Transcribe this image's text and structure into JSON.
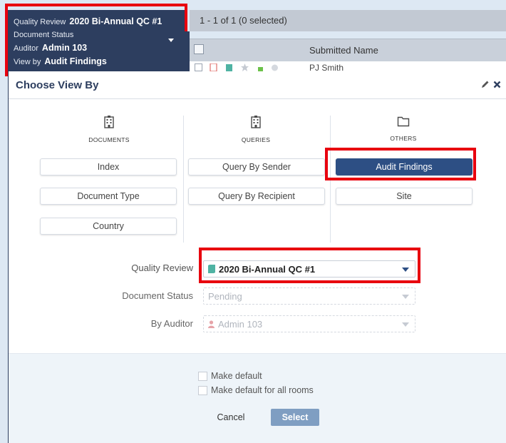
{
  "context": {
    "quality_review_label": "Quality Review",
    "quality_review_value": "2020 Bi-Annual QC #1",
    "document_status_label": "Document Status",
    "auditor_label": "Auditor",
    "auditor_value": "Admin 103",
    "view_by_label": "View by",
    "view_by_value": "Audit Findings"
  },
  "results": {
    "summary": "1 - 1 of 1 (0 selected)",
    "column_submitted_name": "Submitted Name",
    "row_submitted_name": "PJ Smith"
  },
  "modal": {
    "title": "Choose View By",
    "categories": [
      {
        "label": "DOCUMENTS",
        "icon": "building-icon",
        "options": [
          "Index",
          "Document Type",
          "Country"
        ]
      },
      {
        "label": "QUERIES",
        "icon": "building-icon",
        "options": [
          "Query By Sender",
          "Query By Recipient"
        ]
      },
      {
        "label": "OTHERS",
        "icon": "folder-icon",
        "options": [
          "Audit Findings",
          "Site"
        ]
      }
    ],
    "selected_option": "Audit Findings",
    "form": {
      "quality_review_label": "Quality Review",
      "quality_review_value": "2020 Bi-Annual QC #1",
      "document_status_label": "Document Status",
      "document_status_value": "Pending",
      "by_auditor_label": "By Auditor",
      "by_auditor_value": "Admin 103"
    },
    "footer": {
      "make_default": "Make default",
      "make_default_all": "Make default for all rooms",
      "cancel": "Cancel",
      "select": "Select"
    }
  },
  "colors": {
    "navy": "#2d3e5f",
    "accent_blue": "#2d4f84",
    "highlight_red": "#e8000e",
    "select_button": "#7f9ec2"
  }
}
